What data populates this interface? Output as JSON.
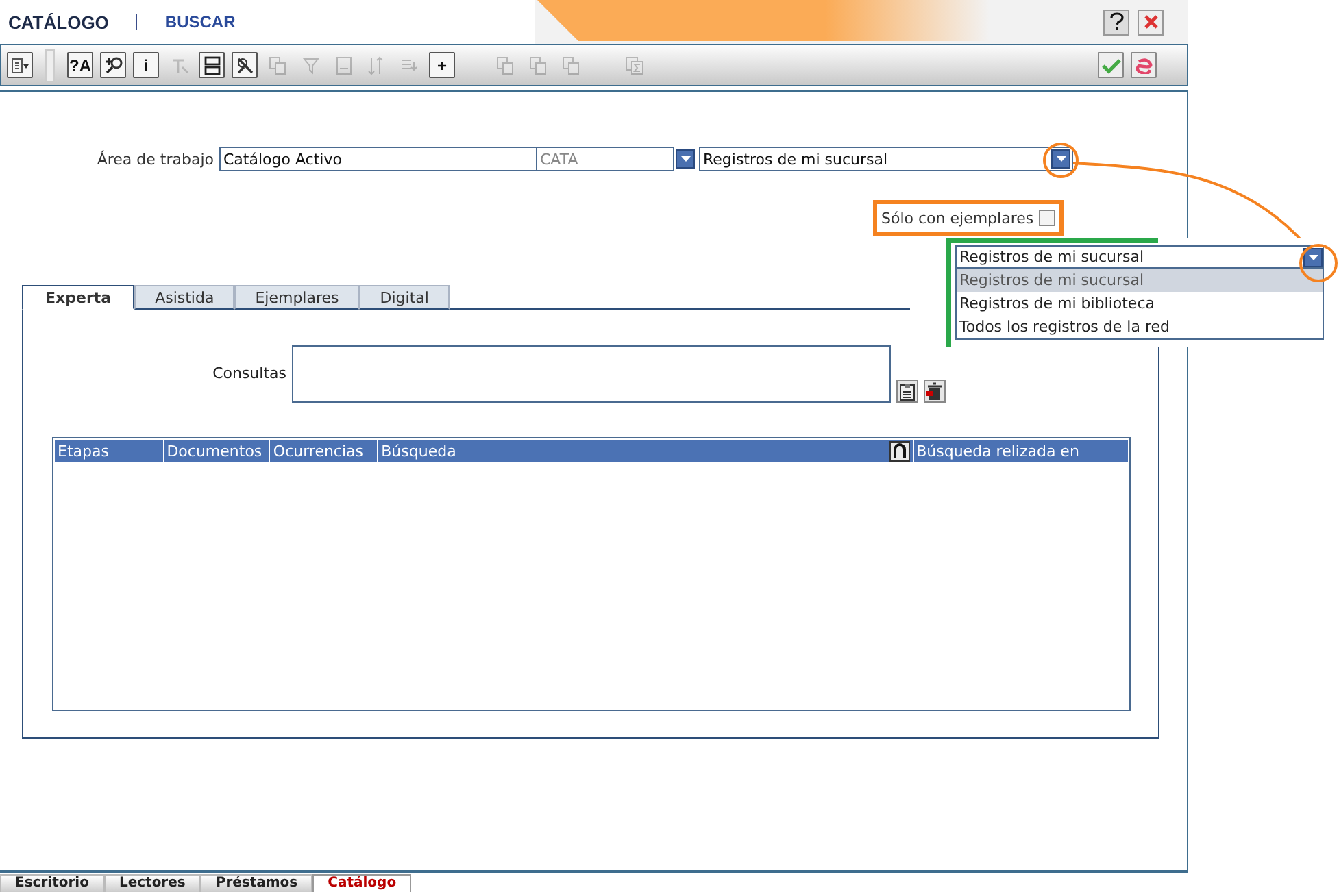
{
  "app": {
    "title": "CATÁLOGO",
    "section": "BUSCAR"
  },
  "toolbar": {
    "tools": [
      {
        "kind": "list-menu",
        "disabled": false
      },
      {
        "kind": "grip",
        "disabled": false
      },
      {
        "kind": "glyph",
        "glyph": "?A",
        "disabled": false
      },
      {
        "kind": "zoom",
        "disabled": false
      },
      {
        "kind": "glyph",
        "glyph": "i",
        "disabled": false
      },
      {
        "kind": "clear",
        "disabled": true
      },
      {
        "kind": "rows",
        "disabled": false
      },
      {
        "kind": "magic",
        "disabled": false
      },
      {
        "kind": "copy",
        "disabled": true
      },
      {
        "kind": "filter",
        "disabled": true
      },
      {
        "kind": "doc",
        "disabled": true
      },
      {
        "kind": "sort",
        "disabled": true
      },
      {
        "kind": "list",
        "disabled": true
      },
      {
        "kind": "glyph",
        "glyph": "+",
        "disabled": false
      },
      {
        "kind": "copy",
        "disabled": true
      },
      {
        "kind": "copy",
        "disabled": true
      },
      {
        "kind": "copy",
        "disabled": true
      },
      {
        "kind": "sum",
        "disabled": true
      }
    ],
    "actions": [
      {
        "kind": "accept"
      },
      {
        "kind": "cancel"
      }
    ]
  },
  "workspace": {
    "label": "Área de trabajo",
    "value": "Catálogo Activo",
    "code": "CATA",
    "scope": "Registros de mi sucursal"
  },
  "only_with_copies": {
    "label": "Sólo con ejemplares",
    "checked": false
  },
  "callout": {
    "value": "Registros de mi sucursal",
    "options": [
      {
        "label": "Registros de mi sucursal",
        "selected": true
      },
      {
        "label": "Registros de mi biblioteca",
        "selected": false
      },
      {
        "label": "Todos los registros de la red",
        "selected": false
      }
    ]
  },
  "search_tabs": [
    {
      "label": "Experta",
      "selected": true
    },
    {
      "label": "Asistida",
      "selected": false
    },
    {
      "label": "Ejemplares",
      "selected": false
    },
    {
      "label": "Digital",
      "selected": false
    }
  ],
  "query": {
    "label": "Consultas"
  },
  "results_table": {
    "columns": [
      {
        "label": "Etapas"
      },
      {
        "label": "Documentos"
      },
      {
        "label": "Ocurrencias"
      },
      {
        "label": "Búsqueda",
        "icon": true
      },
      {
        "label": "Búsqueda relizada en"
      }
    ]
  },
  "bottom_tabs": [
    {
      "label": "Escritorio",
      "selected": false
    },
    {
      "label": "Lectores",
      "selected": false
    },
    {
      "label": "Préstamos",
      "selected": false
    },
    {
      "label": "Catálogo",
      "selected": true
    }
  ]
}
